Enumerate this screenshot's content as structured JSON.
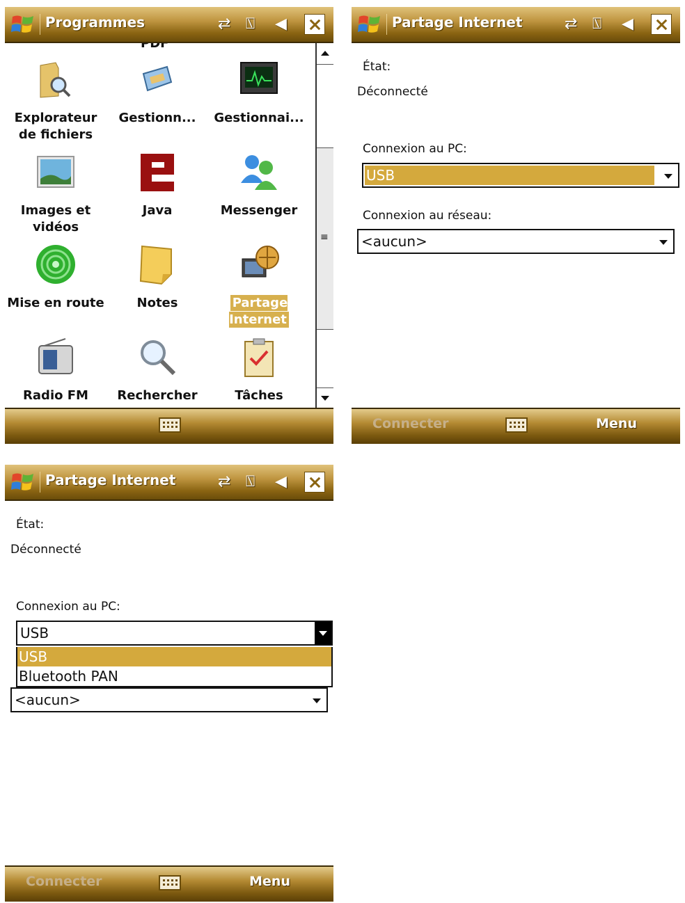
{
  "screen1": {
    "title": "Programmes",
    "partial_top_label": "PDF",
    "items": [
      {
        "label": "Explorateur de fichiers",
        "icon": "folder-search-icon"
      },
      {
        "label": "Gestionn...",
        "icon": "memory-card-icon"
      },
      {
        "label": "Gestionnai...",
        "icon": "task-manager-monitor-icon"
      },
      {
        "label": "Images et vidéos",
        "icon": "picture-icon"
      },
      {
        "label": "Java",
        "icon": "java-e-icon"
      },
      {
        "label": "Messenger",
        "icon": "messenger-people-icon"
      },
      {
        "label": "Mise en route",
        "icon": "green-orb-icon"
      },
      {
        "label": "Notes",
        "icon": "sticky-note-icon"
      },
      {
        "label": "Partage Internet",
        "icon": "internet-sharing-icon"
      },
      {
        "label": "Radio FM",
        "icon": "radio-icon"
      },
      {
        "label": "Rechercher",
        "icon": "magnifier-icon"
      },
      {
        "label": "Tâches",
        "icon": "clipboard-check-icon"
      }
    ],
    "selected_item": "Partage Internet",
    "softkeys": {
      "left": "",
      "right": ""
    }
  },
  "screen2": {
    "title": "Partage Internet",
    "state_label": "État:",
    "state_value": "Déconnecté",
    "pc_label": "Connexion au PC:",
    "pc_value": "USB",
    "net_label": "Connexion au réseau:",
    "net_value": "<aucun>",
    "softkeys": {
      "left": "Connecter",
      "right": "Menu"
    }
  },
  "screen3": {
    "title": "Partage Internet",
    "state_label": "État:",
    "state_value": "Déconnecté",
    "pc_label": "Connexion au PC:",
    "pc_value": "USB",
    "pc_options": [
      "USB",
      "Bluetooth PAN"
    ],
    "pc_selected_option": "USB",
    "net_value": "<aucun>",
    "softkeys": {
      "left": "Connecter",
      "right": "Menu"
    }
  },
  "colors": {
    "titlebar_gold": "#bf9540",
    "highlight_gold": "#d4a93d",
    "title_text": "#ffffff"
  }
}
